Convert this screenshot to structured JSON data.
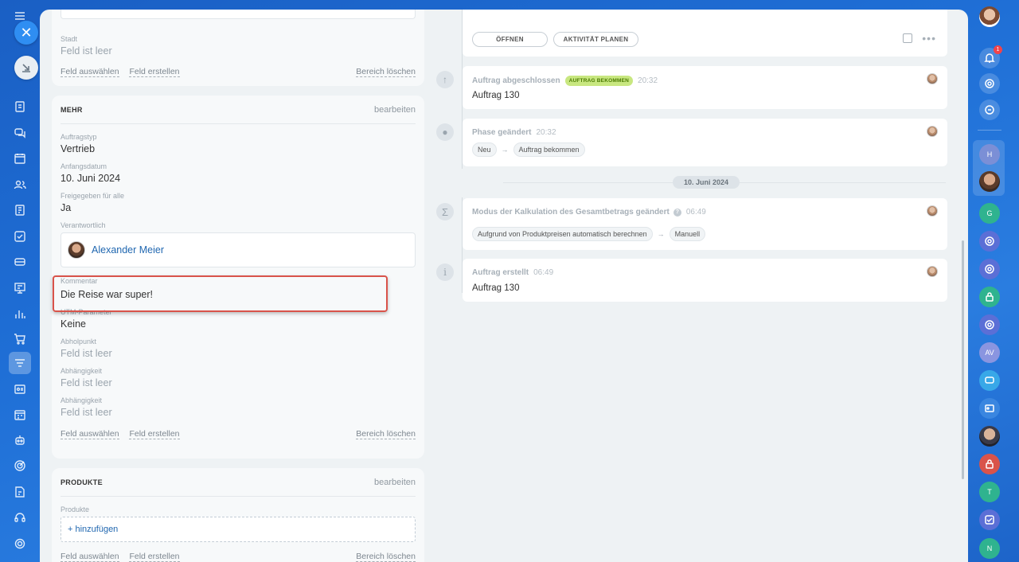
{
  "left_card_top": {
    "city_label": "Stadt",
    "city_value": "Feld ist leer",
    "link_select": "Feld auswählen",
    "link_create": "Feld erstellen",
    "link_clear": "Bereich löschen"
  },
  "mehr_card": {
    "title": "MEHR",
    "edit": "bearbeiten",
    "fields": [
      {
        "label": "Auftragstyp",
        "value": "Vertrieb"
      },
      {
        "label": "Anfangsdatum",
        "value": "10. Juni 2024"
      },
      {
        "label": "Freigegeben für alle",
        "value": "Ja"
      }
    ],
    "responsible_label": "Verantwortlich",
    "responsible_name": "Alexander Meier",
    "comment_label": "Kommentar",
    "comment_value": "Die Reise war super!",
    "fields_after": [
      {
        "label": "UTM-Parameter",
        "value": "Keine"
      },
      {
        "label": "Abholpunkt",
        "value": "Feld ist leer"
      },
      {
        "label": "Abhängigkeit",
        "value": "Feld ist leer"
      },
      {
        "label": "Abhängigkeit",
        "value": "Feld ist leer"
      }
    ],
    "link_select": "Feld auswählen",
    "link_create": "Feld erstellen",
    "link_clear": "Bereich löschen"
  },
  "produkte_card": {
    "title": "PRODUKTE",
    "edit": "bearbeiten",
    "products_label": "Produkte",
    "add_label": "+ hinzufügen",
    "link_select": "Feld auswählen",
    "link_create": "Feld erstellen",
    "link_clear": "Bereich löschen"
  },
  "timeline": {
    "top_card": {
      "open_label": "ÖFFNEN",
      "plan_label": "AKTIVITÄT PLANEN"
    },
    "events": [
      {
        "title": "Auftrag abgeschlossen",
        "badge": "AUFTRAG BEKOMMEN",
        "time": "20:32",
        "text": "Auftrag 130"
      },
      {
        "title": "Phase geändert",
        "time": "20:32",
        "chip_from": "Neu",
        "chip_to": "Auftrag bekommen"
      },
      {
        "title": "Modus der Kalkulation des Gesamtbetrags geändert",
        "time": "06:49",
        "chip_from": "Aufgrund von Produktpreisen automatisch berechnen",
        "chip_to": "Manuell"
      },
      {
        "title": "Auftrag erstellt",
        "time": "06:49",
        "text": "Auftrag 130"
      }
    ],
    "date_separator": "10. Juni 2024",
    "arrow": "→"
  },
  "rightbar": {
    "notification_count": "1",
    "avatars": [
      {
        "initial": "H",
        "color": "#7b8fd6"
      },
      {
        "initial": "G",
        "color": "#2fb38f"
      },
      {
        "initial": "AV",
        "color": "#8a95e0"
      },
      {
        "initial": "T",
        "color": "#2fb38f"
      },
      {
        "initial": "N",
        "color": "#2fb38f"
      }
    ]
  },
  "colors": {
    "accent_blue": "#2067b0",
    "highlight_red": "#d9534a",
    "badge_green": "#c8e780"
  }
}
